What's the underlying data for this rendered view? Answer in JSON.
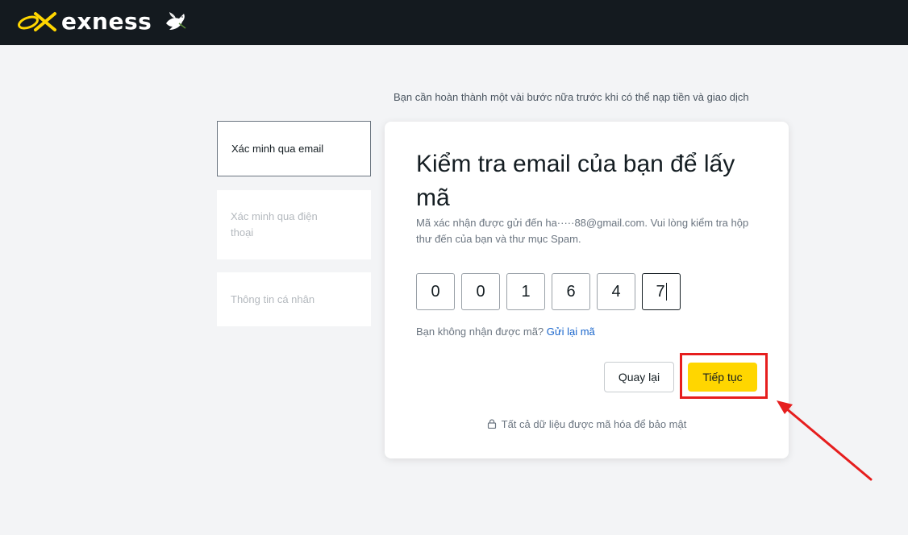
{
  "header": {
    "brand": "exness",
    "colors": {
      "bar": "#141a1f",
      "accent": "#ffd600"
    }
  },
  "notice": "Bạn cần hoàn thành một vài bước nữa trước khi có thể nạp tiền và giao dịch",
  "steps": [
    {
      "label": "Xác minh qua email",
      "state": "active"
    },
    {
      "label": "Xác minh qua điện thoại",
      "state": "inactive"
    },
    {
      "label": "Thông tin cá nhân",
      "state": "inactive"
    }
  ],
  "card": {
    "title": "Kiểm tra email của bạn để lấy mã",
    "description": "Mã xác nhận được gửi đến ha·····88@gmail.com. Vui lòng kiểm tra hộp thư đến của bạn và thư mục Spam.",
    "code_digits": [
      "0",
      "0",
      "1",
      "6",
      "4",
      "7"
    ],
    "resend_prompt": "Bạn không nhận được mã?",
    "resend_link": "Gửi lại mã",
    "back_label": "Quay lại",
    "continue_label": "Tiếp tục",
    "secure_note": "Tất cả dữ liệu được mã hóa để bảo mật"
  },
  "annotation": {
    "color": "#e61e1e"
  }
}
